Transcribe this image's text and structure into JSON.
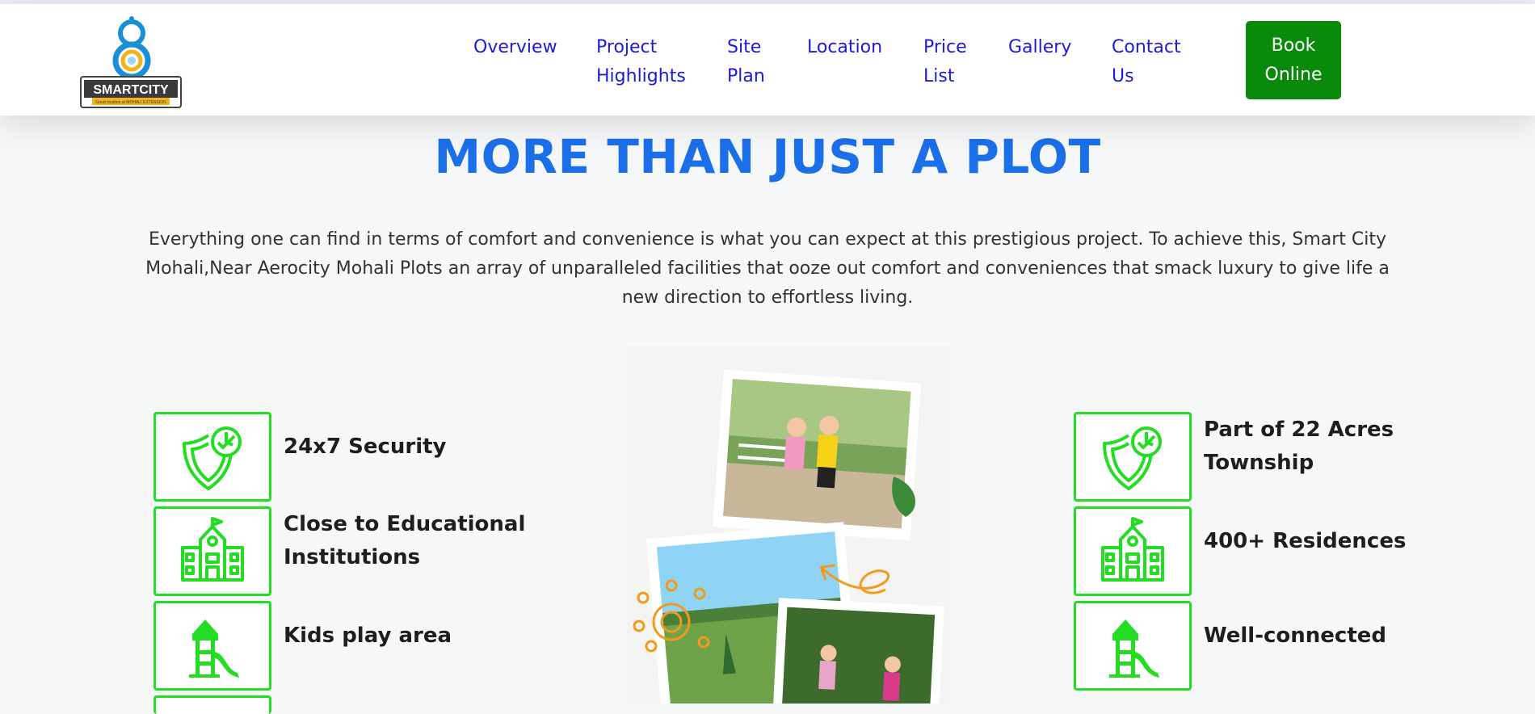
{
  "header": {
    "logo": {
      "brand": "SMARTCITY",
      "tagline": "Great location at MOHALI EXTENSION"
    },
    "nav": [
      {
        "label": "Overview",
        "icon": ""
      },
      {
        "label": "Project Highlights"
      },
      {
        "label": "Site Plan"
      },
      {
        "label": "Location"
      },
      {
        "label": "Price List"
      },
      {
        "label": "Gallery"
      },
      {
        "label": "Contact Us"
      }
    ],
    "book_label": "Book Online"
  },
  "section": {
    "title": "MORE THAN JUST A PLOT",
    "intro": "Everything one can find in terms of comfort and convenience is what you can expect at this prestigious project. To achieve this, Smart City Mohali,Near Aerocity Mohali Plots an array of unparalleled facilities that ooze out comfort and conveniences that smack luxury to give life a new direction to effortless living."
  },
  "features_left": [
    {
      "label": "24x7 Security",
      "icon": "shield-clock-icon"
    },
    {
      "label": "Close to Educational Institutions",
      "icon": "school-building-icon"
    },
    {
      "label": "Kids play area",
      "icon": "playground-icon"
    }
  ],
  "features_right": [
    {
      "label": "Part of 22 Acres Township",
      "icon": "shield-clock-icon"
    },
    {
      "label": "400+ Residences",
      "icon": "school-building-icon"
    },
    {
      "label": "Well-connected",
      "icon": "playground-icon"
    }
  ],
  "colors": {
    "accent_green": "#22dd22",
    "button_green": "#0a8a0a",
    "title_blue": "#1b6fe8",
    "nav_blue": "#1d1ad8"
  }
}
